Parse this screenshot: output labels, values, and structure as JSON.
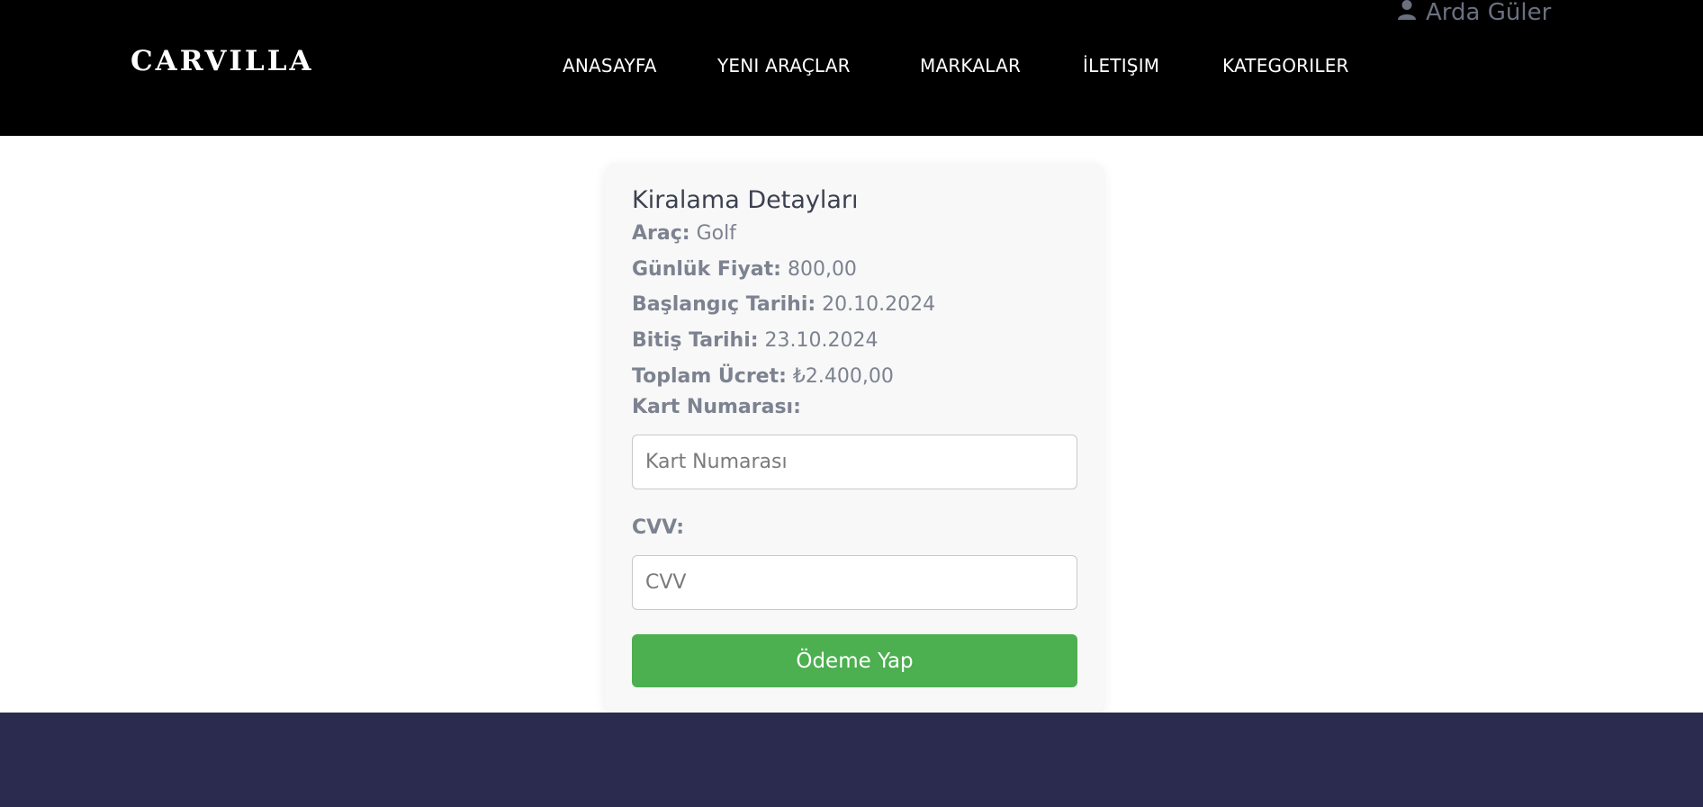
{
  "header": {
    "brand": "CARVILLA",
    "nav": [
      {
        "label": "ANASAYFA"
      },
      {
        "label": "YENI ARAÇLAR"
      },
      {
        "label": "MARKALAR"
      },
      {
        "label": "İLETIŞIM"
      },
      {
        "label": "KATEGORILER"
      }
    ],
    "user": {
      "name": "Arda Güler",
      "icon": "user-icon"
    }
  },
  "card": {
    "title": "Kiralama Detayları",
    "details": [
      {
        "label": "Araç:",
        "value": "Golf"
      },
      {
        "label": "Günlük Fiyat:",
        "value": "800,00"
      },
      {
        "label": "Başlangıç Tarihi:",
        "value": "20.10.2024"
      },
      {
        "label": "Bitiş Tarihi:",
        "value": "23.10.2024"
      },
      {
        "label": "Toplam Ücret:",
        "value": "₺2.400,00"
      }
    ],
    "card_number": {
      "label": "Kart Numarası:",
      "placeholder": "Kart Numarası",
      "value": ""
    },
    "cvv": {
      "label": "CVV:",
      "placeholder": "CVV",
      "value": ""
    },
    "submit_label": "Ödeme Yap"
  },
  "colors": {
    "header_bg": "#000000",
    "footer_bg": "#2b2b50",
    "button_bg": "#4caf50",
    "card_bg": "#f8f8f8"
  }
}
